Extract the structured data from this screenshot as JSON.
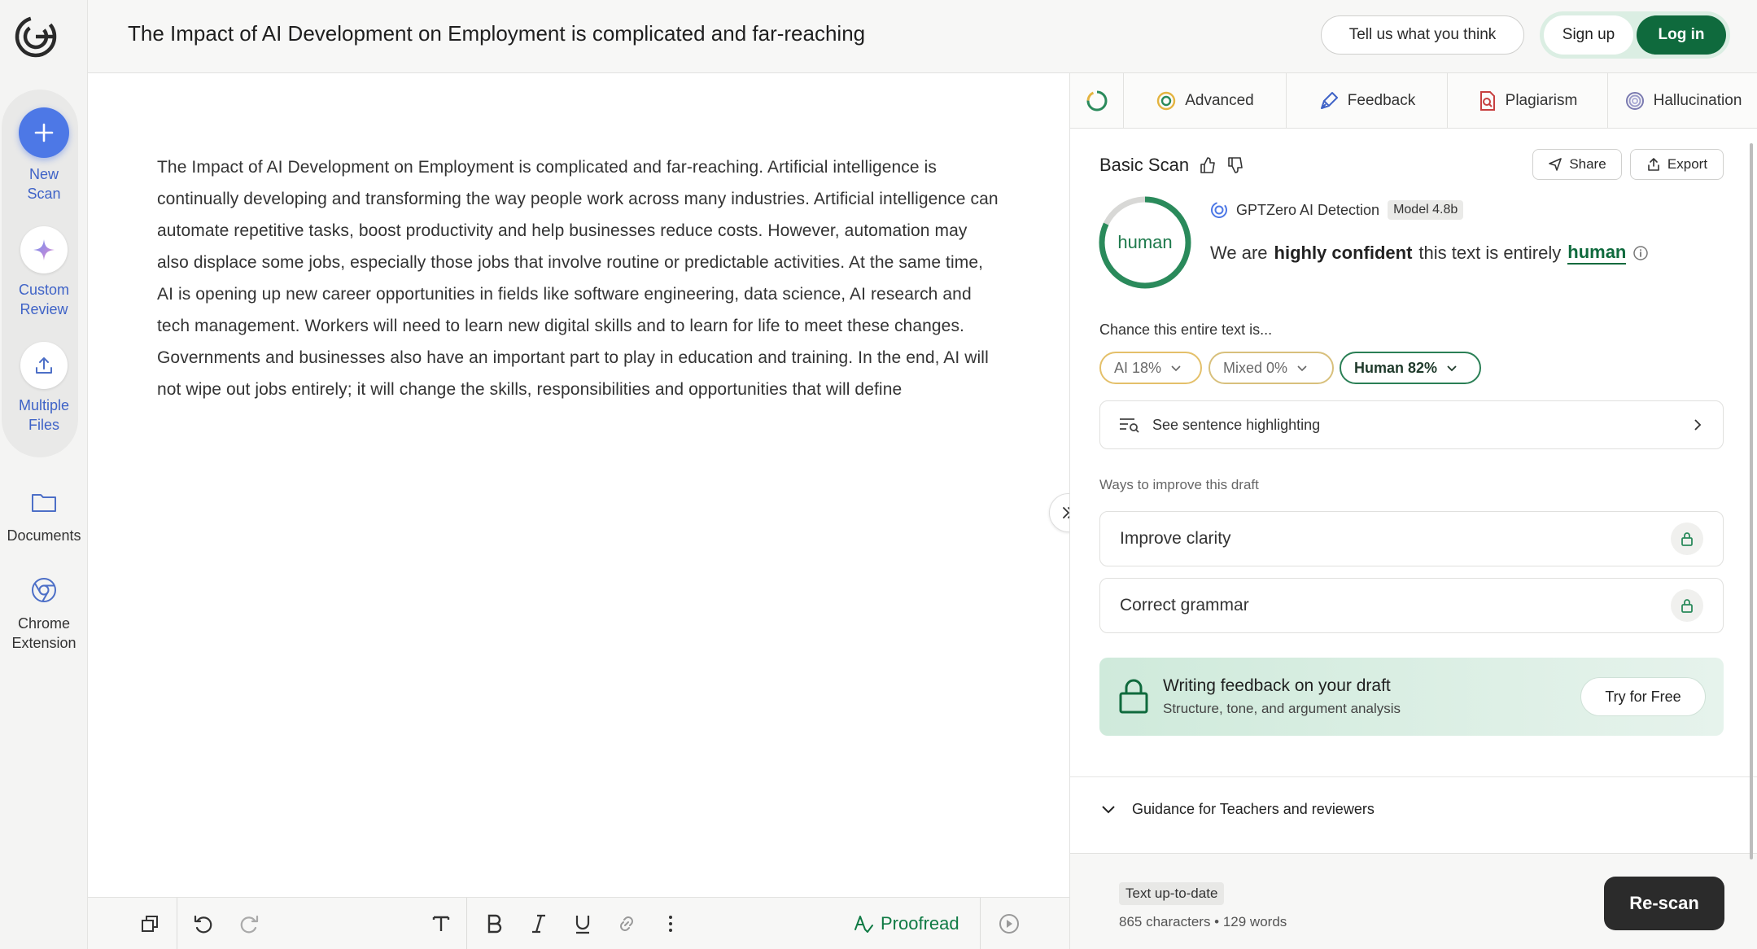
{
  "header": {
    "title": "The Impact of AI Development on Employment is complicated and far-reaching",
    "feedback_label": "Tell us what you think",
    "signup_label": "Sign up",
    "login_label": "Log in"
  },
  "rail": {
    "new_scan": "New Scan",
    "custom_review": "Custom Review",
    "multiple_files": "Multiple Files",
    "documents": "Documents",
    "chrome_extension": "Chrome Extension"
  },
  "editor": {
    "text": "The Impact of AI Development on Employment is complicated and far-reaching. Artificial intelligence is continually developing and transforming the way people work across many industries. Artificial intelligence can automate repetitive tasks, boost productivity and help businesses reduce costs. However, automation may also displace some jobs, especially those jobs that involve routine or predictable activities. At the same time, AI is opening up new career opportunities in fields like software engineering, data science, AI research and tech management. Workers will need to learn new digital skills and to learn for life to meet these changes. Governments and businesses also have an important part to play in education and training. In the end, AI will not wipe out jobs entirely; it will change the skills, responsibilities and opportunities that will define"
  },
  "toolbar": {
    "proofread_label": "Proofread"
  },
  "panel": {
    "tabs": [
      {
        "label": "Advanced"
      },
      {
        "label": "Feedback"
      },
      {
        "label": "Plagiarism"
      },
      {
        "label": "Hallucination"
      }
    ],
    "scan_title": "Basic Scan",
    "share_label": "Share",
    "export_label": "Export",
    "ring_label": "human",
    "ring_fraction": 0.82,
    "detector": "GPTZero AI Detection",
    "model": "Model 4.8b",
    "confidence": {
      "prefix": "We are",
      "strong": "highly confident",
      "middle": "this text is entirely",
      "verdict": "human"
    },
    "chance_label": "Chance this entire text is...",
    "chips": {
      "ai": "AI 18%",
      "mixed": "Mixed 0%",
      "human": "Human 82%"
    },
    "sentence_highlighting": "See sentence highlighting",
    "ways_label": "Ways to improve this draft",
    "improve_clarity": "Improve clarity",
    "correct_grammar": "Correct grammar",
    "promo": {
      "title": "Writing feedback on your draft",
      "subtitle": "Structure, tone, and argument analysis",
      "button": "Try for Free"
    },
    "guidance": "Guidance for Teachers and reviewers",
    "footer": {
      "status": "Text up-to-date",
      "counts": "865 characters • 129 words",
      "rescan": "Re-scan"
    }
  },
  "colors": {
    "brand_green": "#0f6a3d",
    "accent_blue": "#4d78e6",
    "human_green": "#2a8a5b"
  }
}
